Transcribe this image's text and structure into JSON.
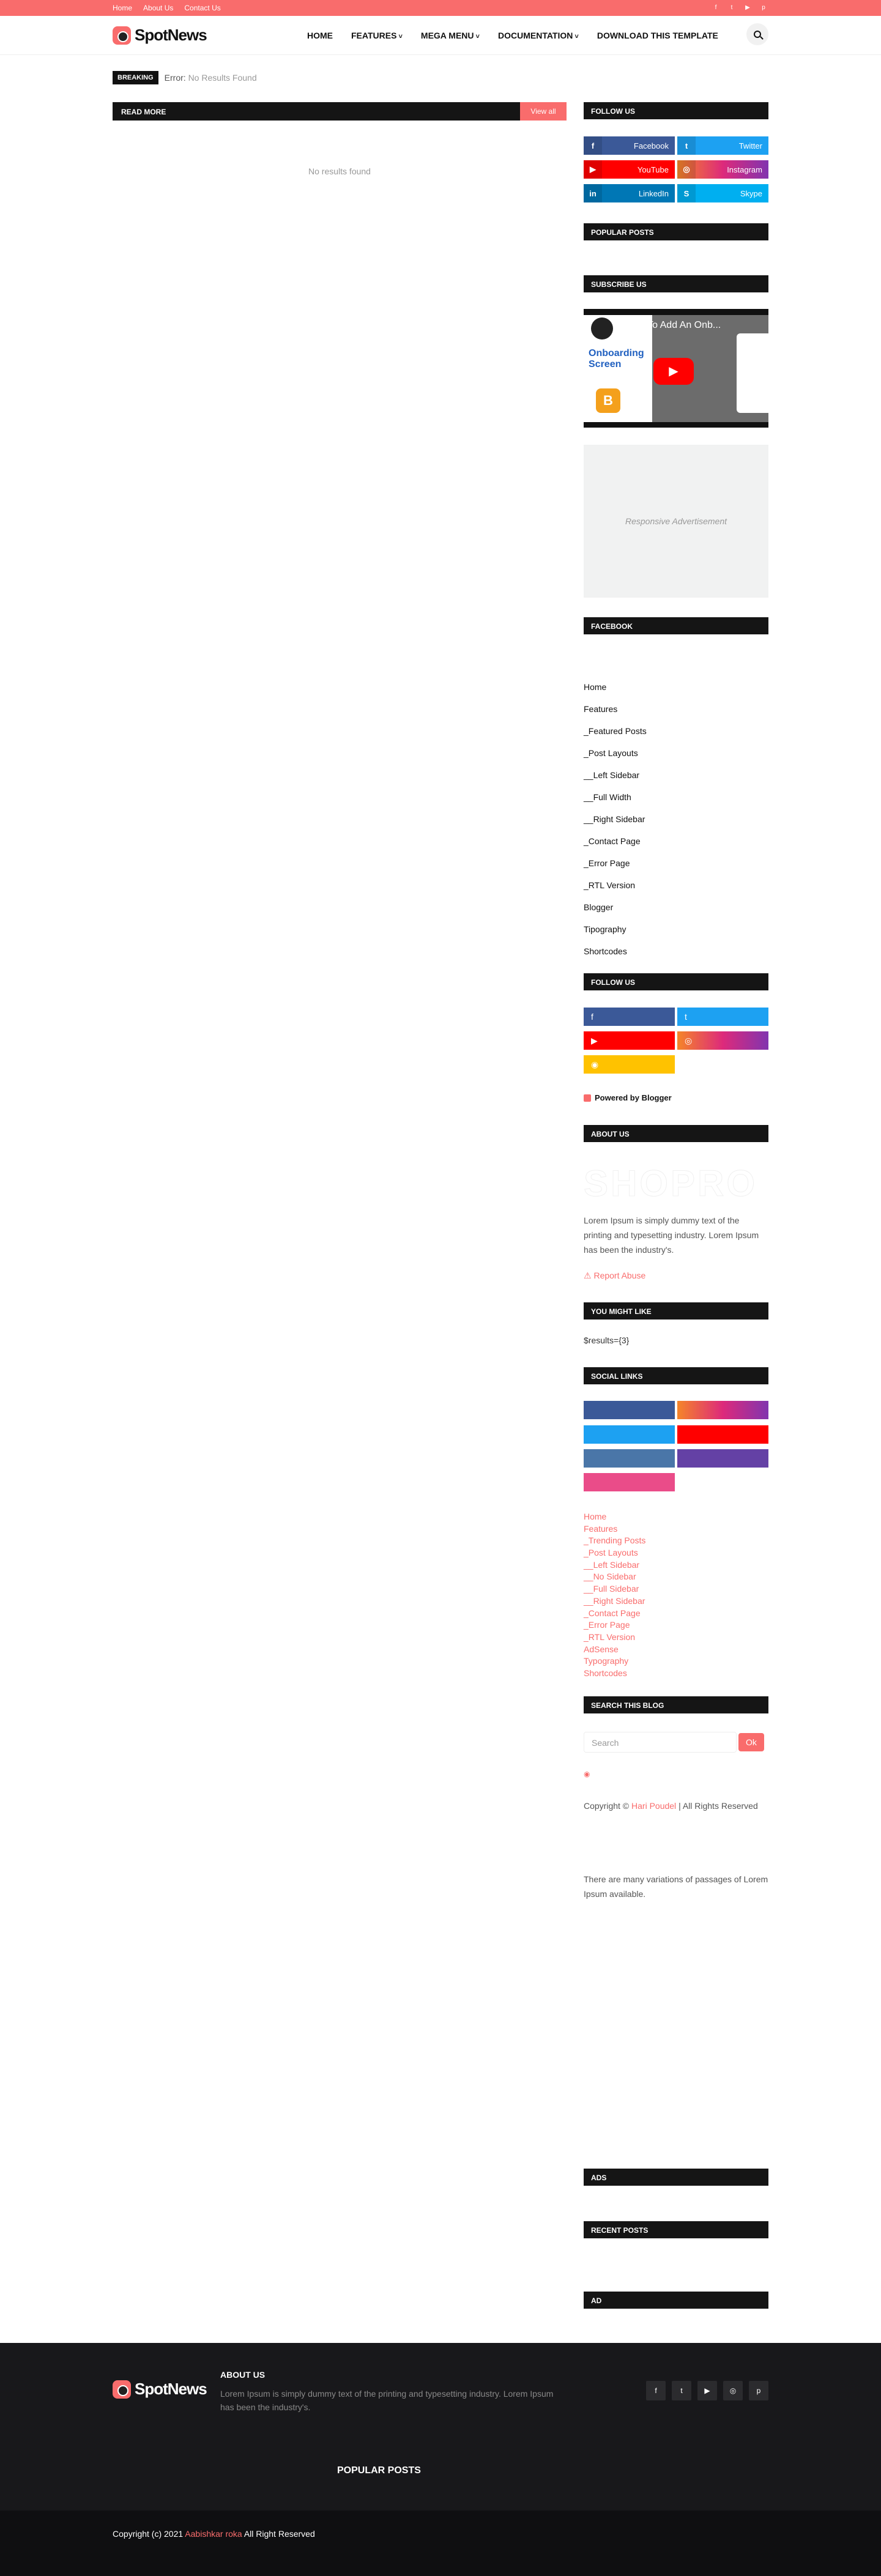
{
  "topbar": {
    "links": [
      "Home",
      "About Us",
      "Contact Us"
    ]
  },
  "header": {
    "logo": "SpotNews",
    "nav": [
      "HOME",
      "FEATURES",
      "MEGA MENU",
      "DOCUMENTATION",
      "DOWNLOAD THIS TEMPLATE"
    ]
  },
  "breaking": {
    "tag": "BREAKING",
    "label": "Error:",
    "text": "No Results Found"
  },
  "main": {
    "section_title": "READ MORE",
    "view_all": "View all",
    "no_results": "No results found"
  },
  "sidebar": {
    "follow_us_title": "FOLLOW US",
    "follow_buttons": [
      "Facebook",
      "Twitter",
      "YouTube",
      "Instagram",
      "LinkedIn",
      "Skype"
    ],
    "popular_title": "POPULAR POSTS",
    "subscribe_title": "SUBSCRIBE US",
    "video": {
      "title": "How To Add An Onb...",
      "overlay": "Onboarding Screen"
    },
    "ad_text": "Responsive Advertisement",
    "facebook_title": "FACEBOOK",
    "menu": [
      "Home",
      "Features",
      "_Featured Posts",
      "_Post Layouts",
      "__Left Sidebar",
      "__Full Width",
      "__Right Sidebar",
      "_Contact Page",
      "_Error Page",
      "_RTL Version",
      "Blogger",
      "Tipography",
      "Shortcodes"
    ],
    "follow_us2_title": "FOLLOW US",
    "powered": "Powered by Blogger",
    "about_title": "ABOUT US",
    "about_logo": "SHOPRO",
    "about_text": "Lorem Ipsum is simply dummy text of the printing and typesetting industry. Lorem Ipsum has been the industry's.",
    "report": "Report Abuse",
    "might_like_title": "YOU MIGHT LIKE",
    "results": "$results={3}",
    "social_title": "SOCIAL LINKS",
    "links": [
      "Home",
      "Features",
      "_Trending Posts",
      "_Post Layouts",
      "__Left Sidebar",
      "__No Sidebar",
      "__Full Sidebar",
      "__Right Sidebar",
      "_Contact Page",
      "_Error Page",
      "_RTL Version",
      "AdSense",
      "Typography",
      "Shortcodes"
    ],
    "search_title": "SEARCH THIS BLOG",
    "search_placeholder": "Search",
    "search_button": "Ok",
    "copyright_prefix": "Copyright ©",
    "copyright_name": "Hari Poudel",
    "copyright_suffix": "| All Rights Reserved",
    "variations": "There are many variations of passages of Lorem Ipsum available.",
    "ads_title": "ADS",
    "recent_title": "RECENT POSTS",
    "ad_title": "AD"
  },
  "footer": {
    "logo": "SpotNews",
    "about_title": "ABOUT US",
    "about_text": "Lorem Ipsum is simply dummy text of the printing and typesetting industry. Lorem Ipsum has been the industry's.",
    "popular_title": "POPULAR POSTS",
    "copy_prefix": "Copyright (c) 2021",
    "copy_name": "Aabishkar roka",
    "copy_suffix": "All Right Reserved"
  },
  "colors": {
    "accent": "#f96c6c",
    "dark": "#151515",
    "facebook": "#3b5998",
    "twitter": "#1da1f2",
    "youtube": "#ff0000",
    "linkedin": "#0077b5",
    "skype": "#00aff0",
    "rss": "#ffc200"
  }
}
